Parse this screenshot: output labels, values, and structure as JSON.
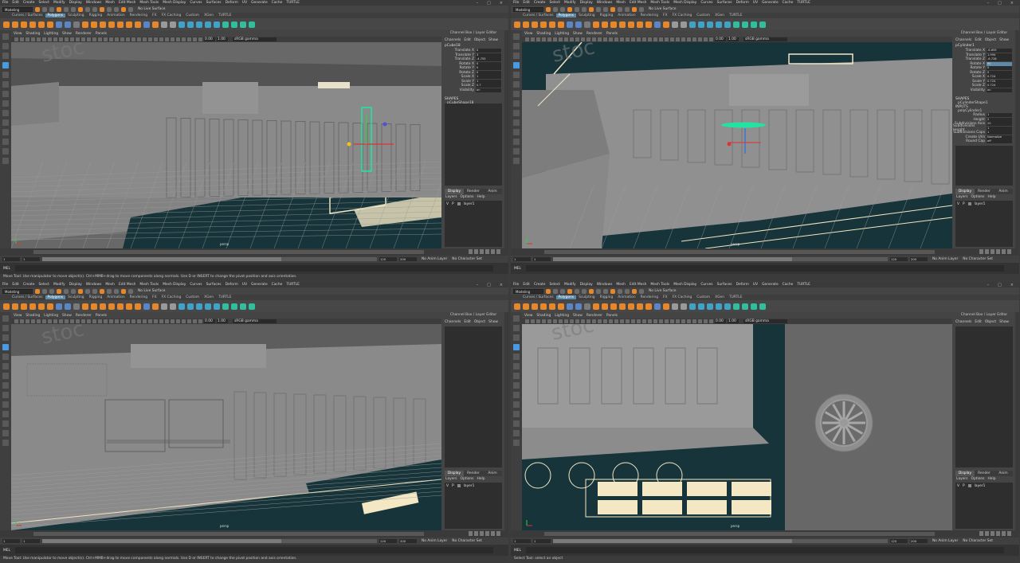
{
  "menu": [
    "File",
    "Edit",
    "Create",
    "Select",
    "Modify",
    "Display",
    "Windows",
    "Mesh",
    "Edit Mesh",
    "Mesh Tools",
    "Mesh Display",
    "Curves",
    "Surfaces",
    "Deform",
    "UV",
    "Generate",
    "Cache",
    "TURTLE"
  ],
  "mode": "Modeling",
  "live_surface": "No Live Surface",
  "shelf_tabs": [
    "Curves / Surfaces",
    "Polygons",
    "Sculpting",
    "Rigging",
    "Animation",
    "Rendering",
    "FX",
    "FX Caching",
    "Custom",
    "XGen",
    "TURTLE"
  ],
  "active_shelf": "Polygons",
  "panel_menu": [
    "View",
    "Shading",
    "Lighting",
    "Show",
    "Renderer",
    "Panels"
  ],
  "near_value": "0.00",
  "far_value": "1.00",
  "color_space": "sRGB gamma",
  "camera_label": "persp",
  "side_title": "Channel Box / Layer Editor",
  "channel_menu": [
    "Channels",
    "Edit",
    "Object",
    "Show"
  ],
  "attr_labels": [
    "Translate X",
    "Translate Y",
    "Translate Z",
    "Rotate X",
    "Rotate Y",
    "Rotate Z",
    "Scale X",
    "Scale Y",
    "Scale Z",
    "Visibility"
  ],
  "shapes_label": "SHAPES",
  "inputs_label": "INPUTS",
  "layer_tabs": [
    "Display",
    "Render",
    "Anim"
  ],
  "layer_menu": [
    "Layers",
    "Options",
    "Help"
  ],
  "layer_name": "layer1",
  "layer_flags": [
    "V",
    "P"
  ],
  "time": {
    "start": "1",
    "current": "1",
    "range_end": "120",
    "end": "120",
    "max": "200",
    "anim_layer": "No Anim Layer",
    "char_set": "No Character Set"
  },
  "mel": "MEL",
  "help_move": "Move Tool: Use manipulator to move object(s). Ctrl+MMB+drag to move components along normals. Use D or INSERT to change the pivot position and axis orientation.",
  "help_select": "Select Tool: select an object",
  "panes": [
    {
      "object": "pCube18",
      "shape": "pCubeShape18",
      "values": [
        "0",
        "3",
        "-4.755",
        "0",
        "0",
        "0",
        "1",
        "1",
        "0.7",
        "on"
      ],
      "selected_attr": -1,
      "inputs": [],
      "layer_visible": true,
      "help": "Move Tool: Use manipulator to move object(s). Ctrl+MMB+drag to move components along normals. Use D or INSERT to change the pivot position and axis orientation."
    },
    {
      "object": "pCylinder1",
      "shape": "pCylinderShape1",
      "values": [
        "-6.659",
        "1.994",
        "-6.728",
        "90",
        "0",
        "0",
        "0.724",
        "0.724",
        "0.724",
        "on"
      ],
      "selected_attr": 3,
      "inputs": [
        [
          "Radius",
          "1"
        ],
        [
          "Height",
          "2"
        ],
        [
          "Subdivisions Axis",
          "20"
        ],
        [
          "Subdivisions Height",
          "1"
        ],
        [
          "Subdivisions Caps",
          "1"
        ],
        [
          "Create UVs",
          "Normalize"
        ],
        [
          "Round Cap",
          "off"
        ]
      ],
      "input_node": "polyCylinder1",
      "layer_visible": true,
      "help": ""
    },
    {
      "object": "",
      "shape": "",
      "values": [],
      "selected_attr": -1,
      "inputs": [],
      "layer_visible": true,
      "help": "Move Tool: Use manipulator to move object(s). Ctrl+MMB+drag to move components along normals. Use D or INSERT to change the pivot position and axis orientation."
    },
    {
      "object": "",
      "shape": "",
      "values": [],
      "selected_attr": -1,
      "inputs": [],
      "layer_visible": true,
      "help": "Select Tool: select an object"
    }
  ],
  "colors": {
    "accent": "#5d8aa8",
    "viewport_bg": "#686868",
    "blueprint": "#17343a",
    "blueprint_line": "#f3e7c4",
    "selection": "#22e3a0",
    "orange_icon": "#e8872a"
  }
}
